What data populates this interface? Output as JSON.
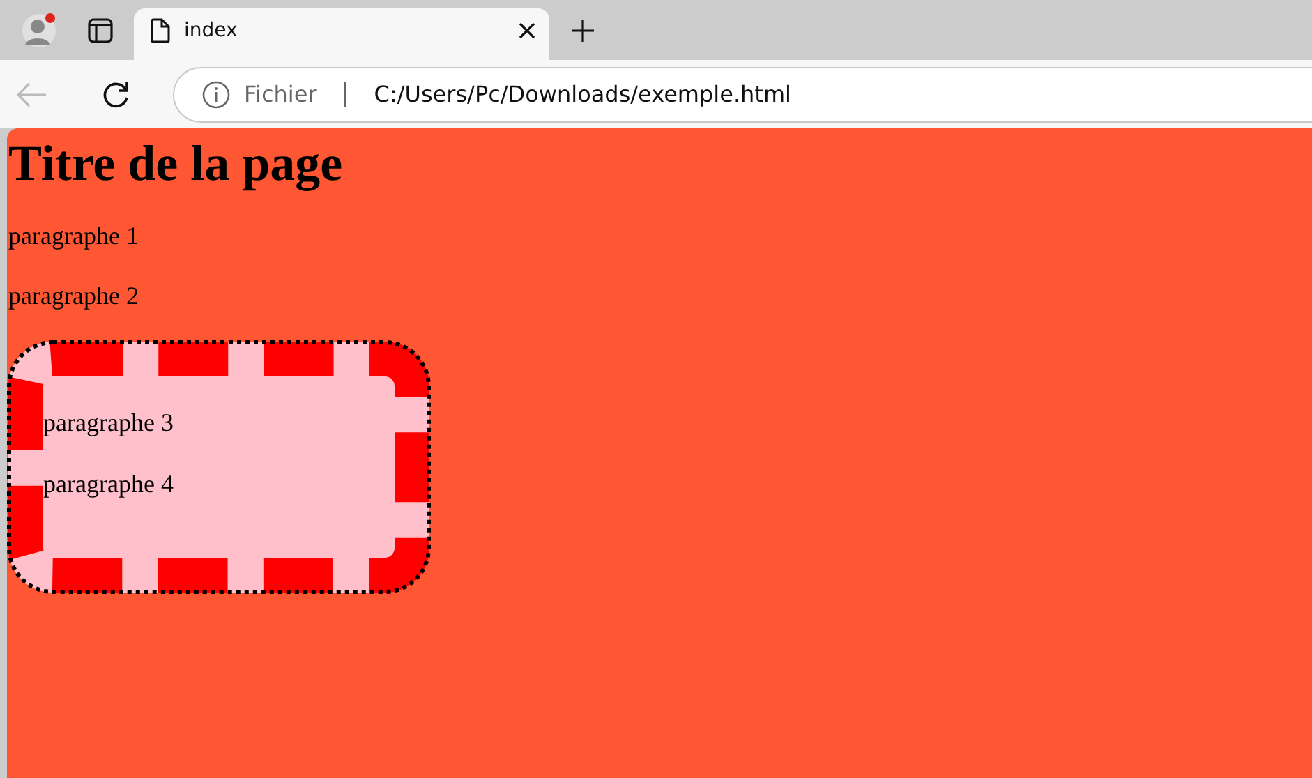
{
  "browser": {
    "tabs": [
      {
        "title": "index",
        "selected": true
      }
    ],
    "address_bar": {
      "scheme_label": "Fichier",
      "url": "C:/Users/Pc/Downloads/exemple.html"
    }
  },
  "page": {
    "title": "Titre de la page",
    "paragraphs": [
      "paragraphe 1",
      "paragraphe 2"
    ],
    "box": {
      "paragraphs": [
        "paragraphe 3",
        "paragraphe 4"
      ]
    }
  }
}
